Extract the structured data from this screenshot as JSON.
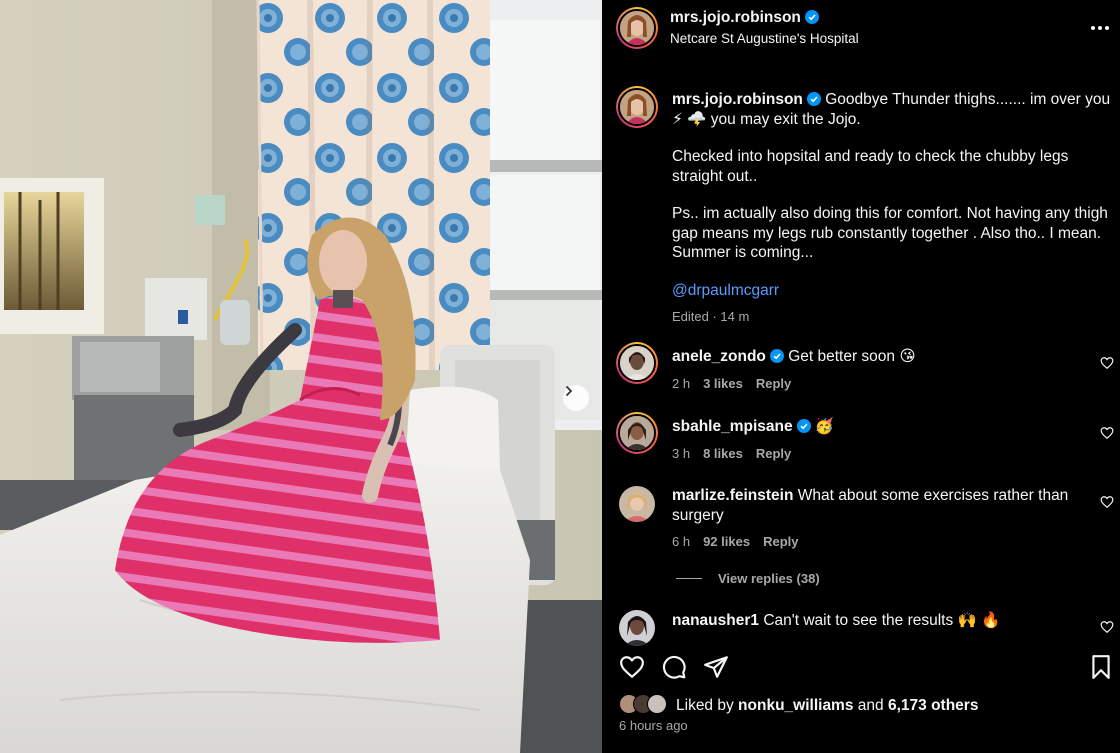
{
  "post": {
    "username": "mrs.jojo.robinson",
    "location": "Netcare St Augustine's Hospital"
  },
  "caption": {
    "username": "mrs.jojo.robinson",
    "line1": "Goodbye Thunder thighs....... im over you ⚡ 🌩️ you may exit the Jojo.",
    "line2": "Checked into hopsital and ready to check the chubby legs straight out..",
    "line3": "Ps.. im actually also doing this for comfort. Not having any thigh gap means my legs rub constantly together . Also tho.. I mean. Summer is coming...",
    "mention": "@drpaulmcgarr",
    "meta": "Edited · 14 m"
  },
  "comments": [
    {
      "username": "anele_zondo",
      "verified": true,
      "text": "Get better soon 😘",
      "time": "2 h",
      "likes": "3 likes",
      "reply": "Reply"
    },
    {
      "username": "sbahle_mpisane",
      "verified": true,
      "text": "🥳",
      "time": "3 h",
      "likes": "8 likes",
      "reply": "Reply"
    },
    {
      "username": "marlize.feinstein",
      "verified": false,
      "text": "What about some exercises rather than surgery",
      "time": "6 h",
      "likes": "92 likes",
      "reply": "Reply"
    },
    {
      "username": "nanausher1",
      "verified": false,
      "text": "Can't wait to see the results 🙌 🔥"
    }
  ],
  "view_replies": "View replies (38)",
  "liked_by": {
    "prefix": "Liked by",
    "user": "nonku_williams",
    "and": "and",
    "others": "6,173 others"
  },
  "time_ago": "6 hours ago",
  "icons": [
    "verified-badge-icon",
    "more-options-icon",
    "heart-icon",
    "comment-icon",
    "share-icon",
    "bookmark-icon",
    "chevron-right-icon"
  ],
  "colors": {
    "accent_link": "#5a9bff",
    "verified": "#0095f6",
    "muted": "#a8a8a8",
    "background": "#000000"
  }
}
